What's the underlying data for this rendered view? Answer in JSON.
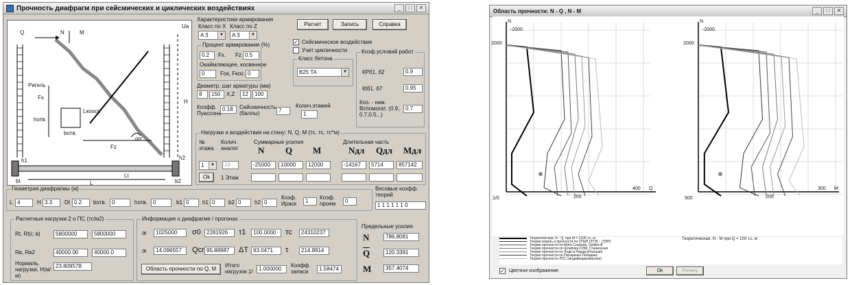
{
  "main_window": {
    "title": "Прочность диафрагм при сейсмических и циклических воздействиях",
    "diagram": {
      "labels": [
        "Q",
        "N",
        "M",
        "Ua",
        "Ригель",
        "Fx",
        "Lкоосп",
        "Fz",
        "H",
        "hотв.",
        "bотв.",
        "Lt",
        "bt",
        "L",
        "h1",
        "b1",
        "h2",
        "b2",
        "αrr"
      ]
    },
    "reinf": {
      "title": "Характеристики армирования",
      "class_x_label": "Класс по X",
      "class_z_label": "Класс по Z",
      "class_x": "A 3",
      "class_z": "A 3"
    },
    "pct": {
      "title": "Процент армирования (%)",
      "fx_val": "0.2",
      "fx_lbl": "Fx.",
      "fz_lbl": "Fz",
      "fz_val": "0.5",
      "open_title": "Окаймляющее, косвенное",
      "open_val": "0",
      "open2_lbl": "Fок, Fкос.",
      "open2_val": "0"
    },
    "diam": {
      "title": "Диаметр, шаг арматуры (мм)",
      "v1": "8",
      "v2": "150",
      "x_lbl": "X,Z",
      "v3": "12",
      "v4": "100"
    },
    "poisson": {
      "label": "Коэфф. Пуассона",
      "value": "0.18"
    },
    "seism": {
      "label": "Сейсмичность (баллы)",
      "value": "7"
    },
    "floors": {
      "label": "Колич.этажей",
      "value": "1"
    },
    "buttons": {
      "calc": "Расчет",
      "write": "Запись",
      "help": "Справка"
    },
    "checks": {
      "seismic": "Сейсмическое воздействие",
      "cyclic": "Учет цикличности"
    },
    "concrete": {
      "title": "Класс бетона",
      "value": "B25 TA"
    },
    "work": {
      "title": "Коэф.условий работ",
      "kr1_lbl": "КРб1, б2",
      "kr1": "0.9",
      "kr2_lbl": "Кtб1, б7",
      "kr2": "0.95",
      "k_lbl": "Коэ. - ниж. Вспомогат. (0.9, 0.7,0.5...)",
      "k": "0.7"
    },
    "loads": {
      "title": "Нагрузки и воздействия на стену:  N, Q, M  (тс, тс, тс*м)",
      "floor_lbl": "№ этажа",
      "count_lbl": "Колич. аналог",
      "total_lbl": "Суммарные усилия",
      "long_lbl": "Длительная часть",
      "floor_val": "1",
      "count_val": "10",
      "h_N": "N",
      "h_Q": "Q",
      "h_M": "M",
      "h_Nl": "Nдл",
      "h_Ql": "Qдл",
      "h_Ml": "Mдл",
      "N": "-25000",
      "Q": "10000",
      "M": "12000",
      "Nl": "-14167",
      "Ql": "5714",
      "Ml": "857142",
      "ok": "Ok",
      "one_floor": "1 Этаж"
    },
    "geom": {
      "title": "Геометрия диафрагмы (м)",
      "L_lbl": "L",
      "L": "4",
      "H_lbl": "H",
      "H": "3.3",
      "Dt_lbl": "Dt",
      "Dt": "0.2",
      "bo_lbl": "bотв.",
      "bo": "0",
      "ho_lbl": "hотв.",
      "ho": "0",
      "b1_lbl": "b1",
      "b1": "0",
      "h1_lbl": "h1",
      "h1": "0",
      "b2_lbl": "b2",
      "b2": "0",
      "h2_lbl": "h2",
      "h2": "0",
      "kr_lbl": "Коэф. Ираск",
      "kr": "1",
      "kp_lbl": "Коэф. проем",
      "kp": "0",
      "weights_lbl": "Весовые коэфф. теорий",
      "weights": "1 1 1 1 1 1 0"
    },
    "calc": {
      "title": "Расчетные нагрузки 2 о ПС (тс/м2)",
      "rt_lbl": "Rt, Rt(r, в)",
      "rt1": "5800000",
      "rt2": "5800000",
      "rb_lbl": "Rв, Rв2",
      "rb1": "40000.00",
      "rb2": "40000.0",
      "nu_lbl": "Нормаль. нагрузки, Н(м/м)",
      "nu": "23.809578"
    },
    "info": {
      "title": "Информация о диафрагме / прогонах",
      "a1": "1025000",
      "o1_lbl": "σ0",
      "o1": "2281926",
      "t1_lbl": "τ1",
      "t1": "100.0000",
      "tc_lbl": "τc",
      "tc": "24310237",
      "a2": "14.096557",
      "q_lbl": "Qcr",
      "q": "95.88987",
      "d_lbl": "ΔT",
      "d": "93.0471",
      "t_lbl": "τ",
      "t": "214.8914",
      "area_btn": "Область прочности по Q, M",
      "it_lbl": "Итого нагрузок 1/",
      "it": "1.000000",
      "kz_lbl": "Коэфф. запаса",
      "kz": "1.58474"
    },
    "limits": {
      "title": "Предельные усилия",
      "N_lbl": "N",
      "N": "786.8081",
      "Q_lbl": "Q",
      "Q": "120.3391",
      "M_lbl": "M",
      "M": "357.4074"
    }
  },
  "plot_window": {
    "title": "Область прочности:  N - Q ,  N - M",
    "left": {
      "y_lbl": "N",
      "y_top": "-2000",
      "y_mid": "2000",
      "y_bot": "1/0",
      "x_mid": "200",
      "x_end": "400",
      "x_lbl": "Q"
    },
    "right": {
      "y_lbl": "N",
      "y_top": "-2000",
      "y_mid": "2000",
      "y_bot": "500",
      "x_mid": "200",
      "x_end": "300",
      "x_lbl": "M"
    },
    "legend": [
      "Теоретическая, N - Q, при M = 1200 т.с. м",
      "Теория коваль и прочности по СНиП (ЗТЭ) – (ЗЭР)",
      "Теория прочности по Mohr-Coulomb, Galileo-B",
      "Теория прочности по Шлейхер-ОЗМ, Сталинская",
      "Теория прочности по Лоде и Надаи-Ильюшин",
      "Теория прочности по Писаренко-Лебедеву",
      "Теория прочности ЛСС (модифицированная)"
    ],
    "legend_right": "Теоретическая, N - M при Q = 100 т.с. м",
    "footer": {
      "check": "Цветное изображение",
      "ok": "Ok",
      "print": "Печать"
    }
  }
}
